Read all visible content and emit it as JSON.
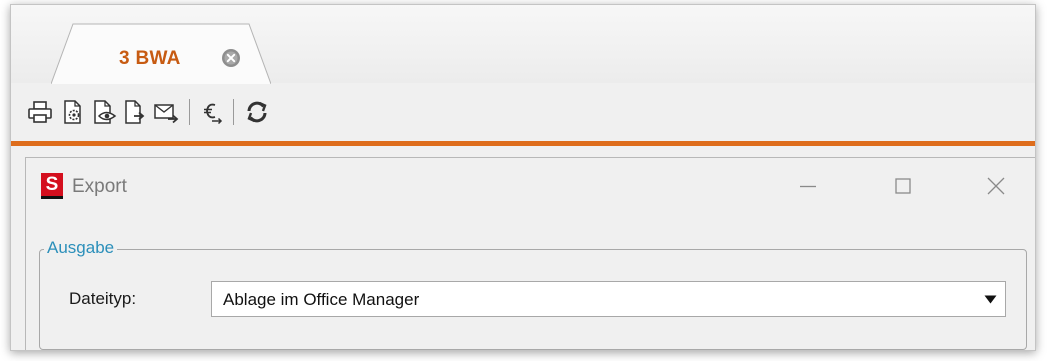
{
  "tab": {
    "label": "3 BWA"
  },
  "toolbar": {
    "icons": [
      "printer-icon",
      "print-settings-icon",
      "print-preview-icon",
      "export-file-icon",
      "email-icon",
      "currency-icon",
      "refresh-icon"
    ]
  },
  "dialog": {
    "logo_letter": "S",
    "title": "Export",
    "group_title": "Ausgabe",
    "file_type_label": "Dateityp:",
    "file_type_value": "Ablage im Office Manager"
  },
  "colors": {
    "accent_orange": "#de6d1c",
    "tab_text": "#c75b12",
    "legend_blue": "#2b8fba",
    "logo_red": "#d40f1e"
  }
}
